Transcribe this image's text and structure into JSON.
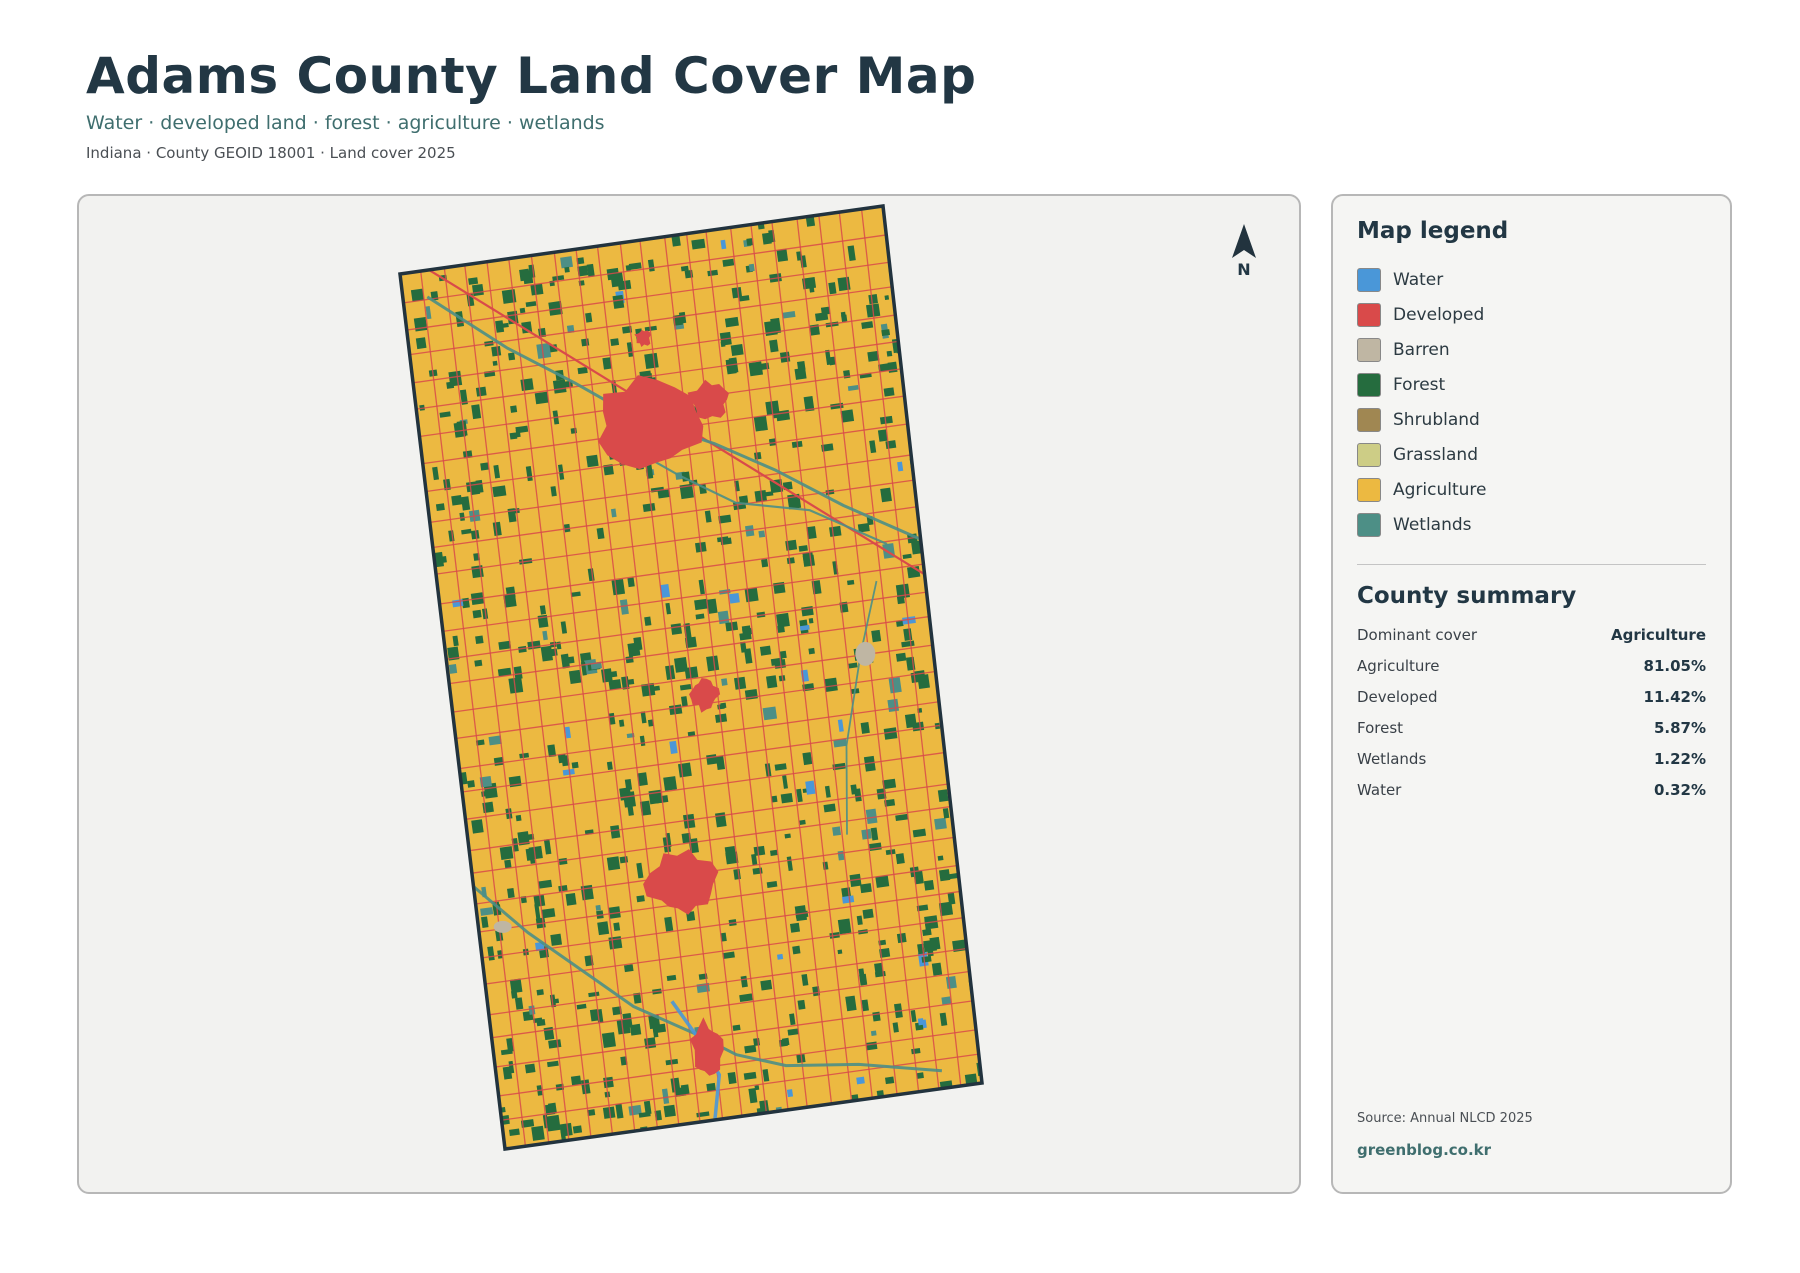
{
  "header": {
    "title": "Adams County Land Cover Map",
    "subtitle": "Water · developed land · forest · agriculture · wetlands",
    "meta": "Indiana · County GEOID 18001 · Land cover 2025"
  },
  "north_arrow": {
    "label": "N",
    "icon": "north-arrow-icon"
  },
  "legend": {
    "heading": "Map legend",
    "items": [
      {
        "label": "Water",
        "color": "#4a97d8"
      },
      {
        "label": "Developed",
        "color": "#d94a4a"
      },
      {
        "label": "Barren",
        "color": "#bfb6a3"
      },
      {
        "label": "Forest",
        "color": "#256c3e"
      },
      {
        "label": "Shrubland",
        "color": "#a08752"
      },
      {
        "label": "Grassland",
        "color": "#cdcd86"
      },
      {
        "label": "Agriculture",
        "color": "#ecb941"
      },
      {
        "label": "Wetlands",
        "color": "#4d8f86"
      }
    ]
  },
  "summary": {
    "heading": "County summary",
    "rows": [
      {
        "key": "Dominant cover",
        "value": "Agriculture"
      },
      {
        "key": "Agriculture",
        "value": "81.05%"
      },
      {
        "key": "Developed",
        "value": "11.42%"
      },
      {
        "key": "Forest",
        "value": "5.87%"
      },
      {
        "key": "Wetlands",
        "value": "1.22%"
      },
      {
        "key": "Water",
        "value": "0.32%"
      }
    ]
  },
  "footer": {
    "source": "Source: Annual NLCD 2025",
    "site": "greenblog.co.kr"
  },
  "map_style": {
    "background": "#f2f2f0",
    "county_fill": "#ecb941",
    "outline": "#22333e",
    "road_color": "#d94a4a",
    "forest_color": "#256c3e",
    "water_color": "#4a97d8",
    "wetland_color": "#4d8f86",
    "developed_color": "#d94a4a",
    "barren_color": "#bfb6a3"
  }
}
